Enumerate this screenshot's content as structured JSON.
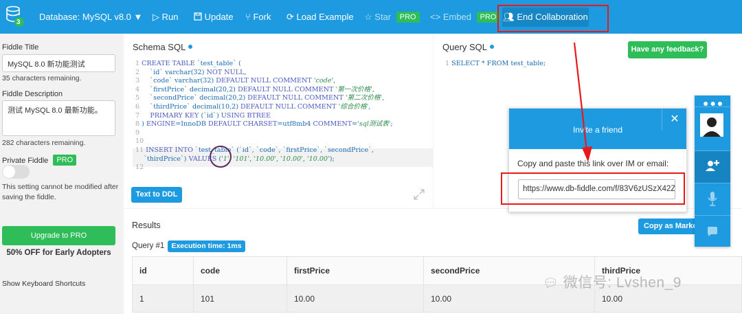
{
  "topbar": {
    "database_label": "Database: MySQL v8.0 ▼",
    "buttons": {
      "run": "Run",
      "update": "Update",
      "fork": "Fork",
      "load_example": "Load Example",
      "star": "Star",
      "embed": "Embed",
      "end_collaboration": "End Collaboration"
    },
    "pro_badge": "PRO",
    "logo_number": "3"
  },
  "sidebar": {
    "title_label": "Fiddle Title",
    "title_value": "MySQL 8.0 新功能测试",
    "title_remaining": "35 characters remaining.",
    "description_label": "Fiddle Description",
    "description_value": "测试 MySQL 8.0 最新功能。",
    "description_remaining": "282 characters remaining.",
    "private_label": "Private Fiddle",
    "private_pro_badge": "PRO",
    "private_note": "This setting cannot be modified after saving the fiddle.",
    "upgrade_button": "Upgrade to PRO",
    "sale_text": "50% OFF for Early Adopters",
    "shortcuts_link": "Show Keyboard Shortcuts"
  },
  "schema": {
    "title": "Schema SQL",
    "text_to_ddl": "Text to DDL",
    "lines": [
      "1",
      "2",
      "3",
      "4",
      "5",
      "6",
      "7",
      "8",
      "9",
      "10",
      "11",
      "12"
    ]
  },
  "query": {
    "title": "Query SQL",
    "line_number": "1",
    "sql": "SELECT * FROM test_table;"
  },
  "feedback_button": "Have any feedback?",
  "invite": {
    "title": "Invite a friend",
    "close": "✕",
    "instructions": "Copy and paste this link over IM or email:",
    "link": "https://www.db-fiddle.com/f/83V6zUSzX42Z"
  },
  "results": {
    "title": "Results",
    "copy_markdown": "Copy as Markdown",
    "query_label": "Query #1",
    "execution_time": "Execution time: 1ms",
    "columns": [
      "id",
      "code",
      "firstPrice",
      "secondPrice",
      "thirdPrice"
    ],
    "rows": [
      [
        "1",
        "101",
        "10.00",
        "10.00",
        "10.00"
      ]
    ]
  },
  "watermark": "微信号: Lvshen_9",
  "colors": {
    "accent": "#1e9be0",
    "green": "#2ebd59",
    "annotation_red": "#e8191b"
  }
}
